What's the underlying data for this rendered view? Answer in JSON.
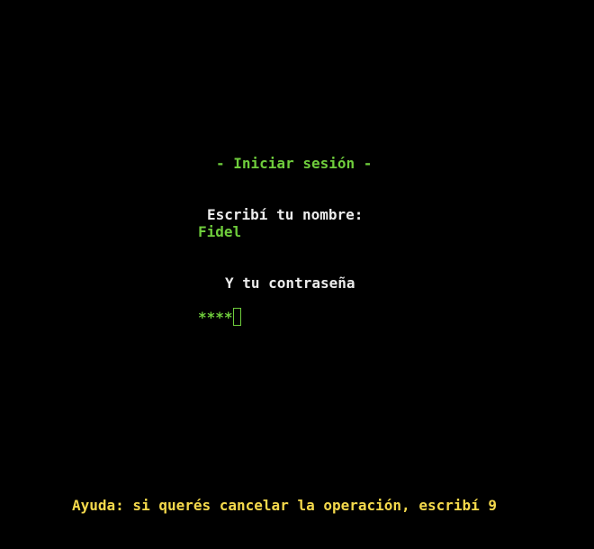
{
  "terminal": {
    "title": "- Iniciar sesión -",
    "name_prompt": "Escribí tu nombre:",
    "name_value": "Fidel",
    "password_prompt": "Y tu contraseña",
    "password_mask": "****",
    "help_text": "Ayuda: si querés cancelar la operación, escribí 9"
  },
  "colors": {
    "background": "#000000",
    "accent_green": "#6fcd3c",
    "text_white": "#ececec",
    "help_yellow": "#f4d94c"
  }
}
